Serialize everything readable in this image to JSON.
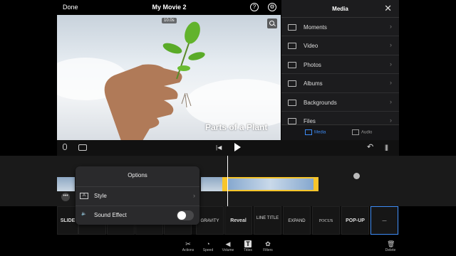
{
  "header": {
    "done_label": "Done",
    "project_title": "My Movie 2"
  },
  "preview": {
    "duration_badge": "10.0s",
    "overlay_title": "Parts of a Plant"
  },
  "media": {
    "title": "Media",
    "items": [
      {
        "label": "Moments",
        "icon": "moments-icon"
      },
      {
        "label": "Video",
        "icon": "video-icon"
      },
      {
        "label": "Photos",
        "icon": "photos-icon"
      },
      {
        "label": "Albums",
        "icon": "albums-icon"
      },
      {
        "label": "Backgrounds",
        "icon": "backgrounds-icon"
      },
      {
        "label": "Files",
        "icon": "files-icon"
      }
    ],
    "tabs": [
      {
        "label": "Media",
        "active": true
      },
      {
        "label": "Audio",
        "active": false
      }
    ]
  },
  "options": {
    "title": "Options",
    "style_label": "Style",
    "sound_effect_label": "Sound Effect",
    "sound_effect_on": false
  },
  "titles_strip": {
    "tiles": [
      "SLIDE",
      "GRAVITY",
      "Reveal",
      "LINE TITLE",
      "EXPAND",
      "FOCUS",
      "POP-UP",
      "—"
    ]
  },
  "toolbar": {
    "actions": "Actions",
    "speed": "Speed",
    "volume": "Volume",
    "titles": "Titles",
    "filters": "Filters",
    "delete": "Delete"
  },
  "colors": {
    "accent": "#3d8bf5",
    "clip_selected": "#f7c52b"
  }
}
